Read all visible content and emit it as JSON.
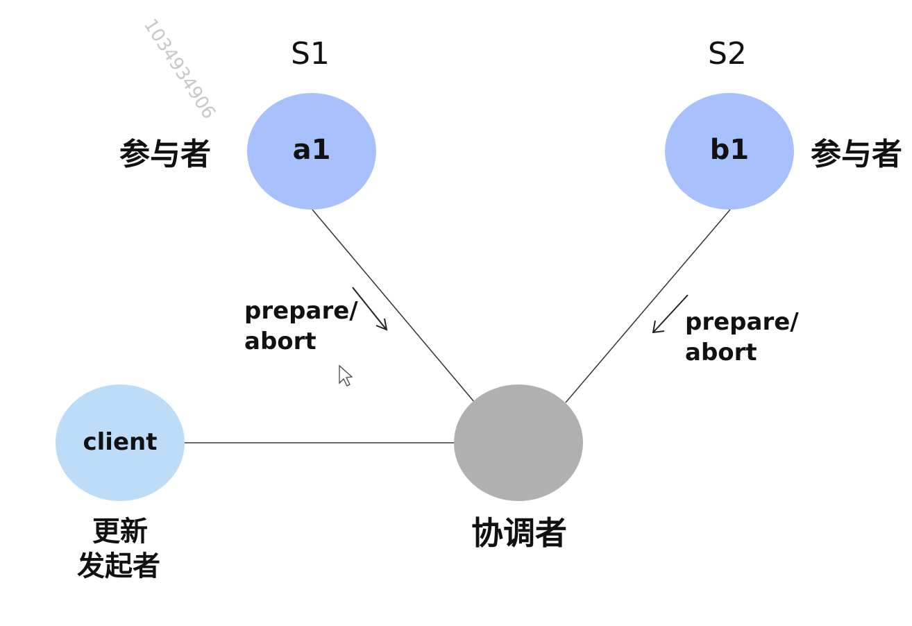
{
  "watermark": "1034934906",
  "servers": {
    "s1": "S1",
    "s2": "S2"
  },
  "nodes": {
    "a1": {
      "label": "a1",
      "role": "参与者",
      "color": "#a8c0fb"
    },
    "b1": {
      "label": "b1",
      "role": "参与者",
      "color": "#a8c0fb"
    },
    "client": {
      "label": "client",
      "role_line1": "更新",
      "role_line2": "发起者",
      "color": "#bcdcf8"
    },
    "coordinator": {
      "label": "",
      "role": "协调者",
      "color": "#b0b0b0"
    }
  },
  "edge_labels": {
    "left_line1": "prepare/",
    "left_line2": "abort",
    "right_line1": "prepare/",
    "right_line2": "abort"
  }
}
